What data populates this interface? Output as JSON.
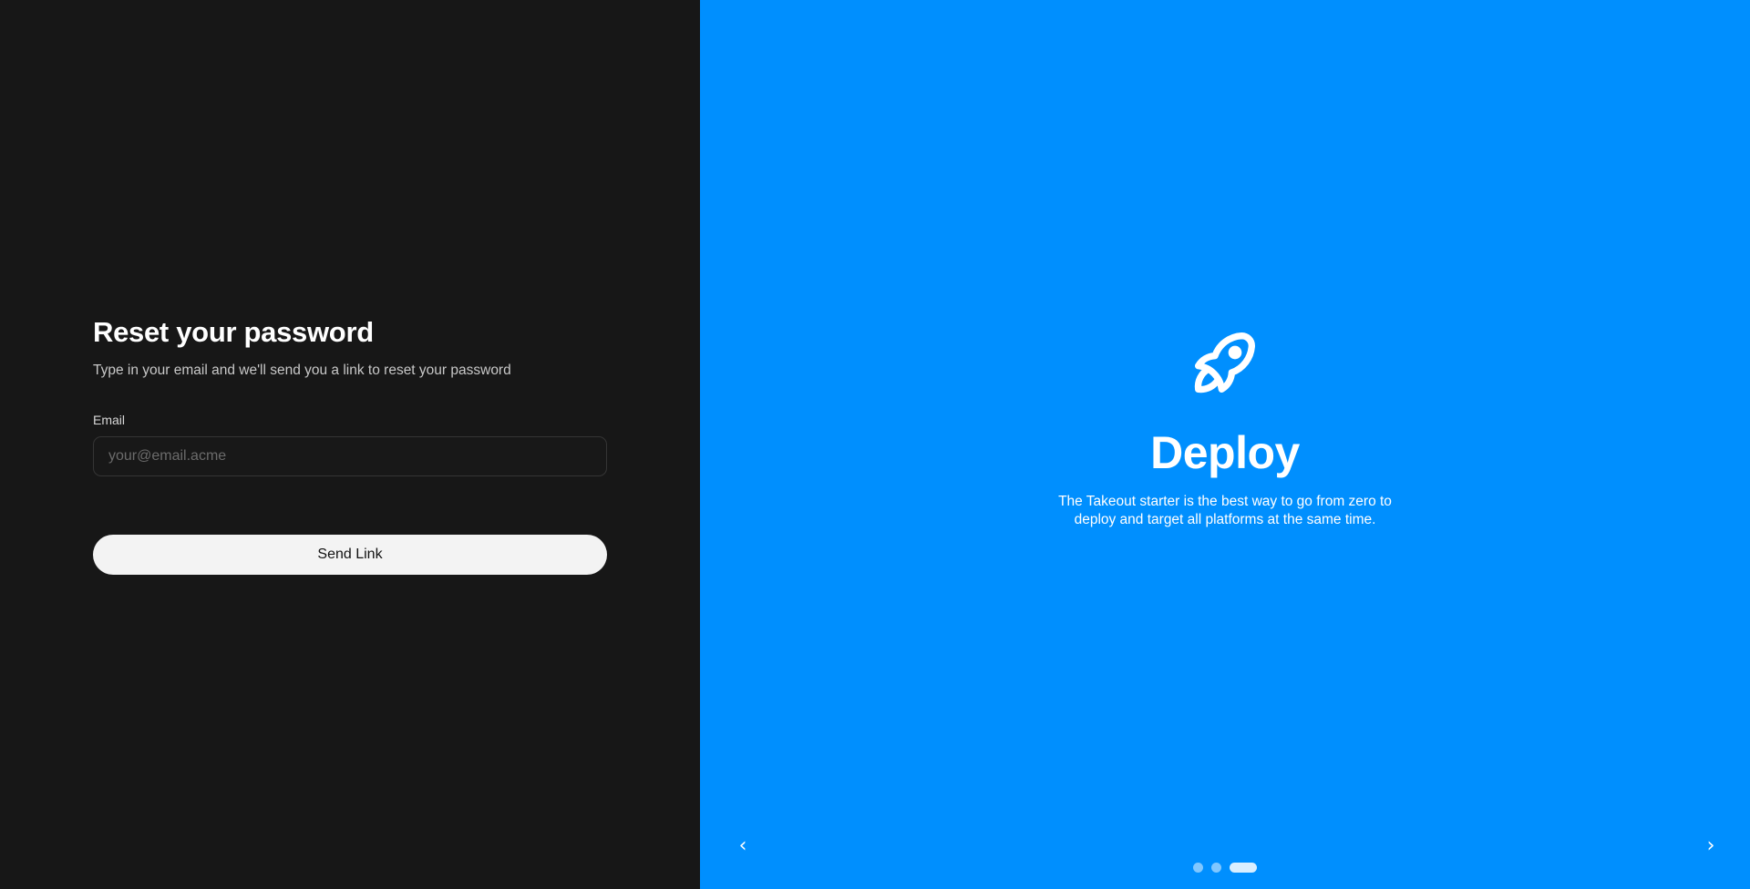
{
  "reset": {
    "title": "Reset your password",
    "subtitle": "Type in your email and we'll send you a link to reset your password",
    "email_label": "Email",
    "email_placeholder": "your@email.acme",
    "email_value": "",
    "submit_label": "Send Link"
  },
  "carousel": {
    "icon": "rocket-icon",
    "title": "Deploy",
    "text": "The Takeout starter is the best way to go from zero to deploy and target all platforms at the same time.",
    "prev_label": "‹",
    "next_label": "›",
    "slide_count": 3,
    "active_index": 2
  },
  "colors": {
    "left_bg": "#171717",
    "right_bg": "#008ffe",
    "button_bg": "#f3f3f3"
  }
}
